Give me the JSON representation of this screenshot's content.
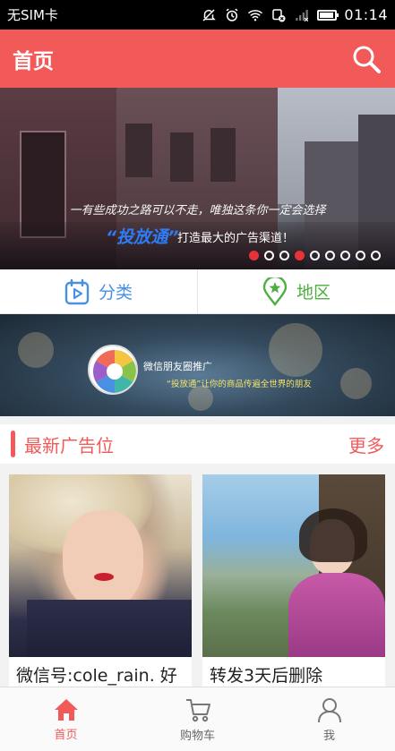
{
  "status_bar": {
    "carrier": "无SIM卡",
    "time": "01:14",
    "icons": [
      "mute-icon",
      "alarm-icon",
      "wifi-icon",
      "data-off-icon",
      "signal-icon",
      "battery-icon"
    ],
    "battery_level": 0.8
  },
  "header": {
    "title": "首页",
    "search_icon": "search-icon"
  },
  "banner": {
    "slogan": "一有些成功之路可以不走，唯独这条你一定会选择",
    "brand": "“投放通”",
    "tagline": "打造最大的广告渠道！",
    "dots_count": 9,
    "active_dots": [
      0,
      3
    ]
  },
  "categories": [
    {
      "label": "分类",
      "icon": "category-icon",
      "color": "#4a90e2"
    },
    {
      "label": "地区",
      "icon": "location-pin-icon",
      "color": "#4caf3f"
    }
  ],
  "promo": {
    "title": "微信朋友圈推广",
    "subtitle": "“投放通”让你的商品传遍全世界的朋友"
  },
  "section": {
    "title": "最新广告位",
    "more_label": "更多"
  },
  "cards": [
    {
      "caption": "微信号:cole_rain. 好"
    },
    {
      "caption": "转发3天后删除"
    }
  ],
  "bottom_nav": [
    {
      "label": "首页",
      "icon": "home-icon",
      "active": true
    },
    {
      "label": "购物车",
      "icon": "cart-icon",
      "active": false
    },
    {
      "label": "我",
      "icon": "user-icon",
      "active": false
    }
  ],
  "colors": {
    "accent": "#f25a5a",
    "status_bar": "#000000",
    "active_dot": "#e8323a",
    "brand_blue": "#2e7cf6"
  }
}
